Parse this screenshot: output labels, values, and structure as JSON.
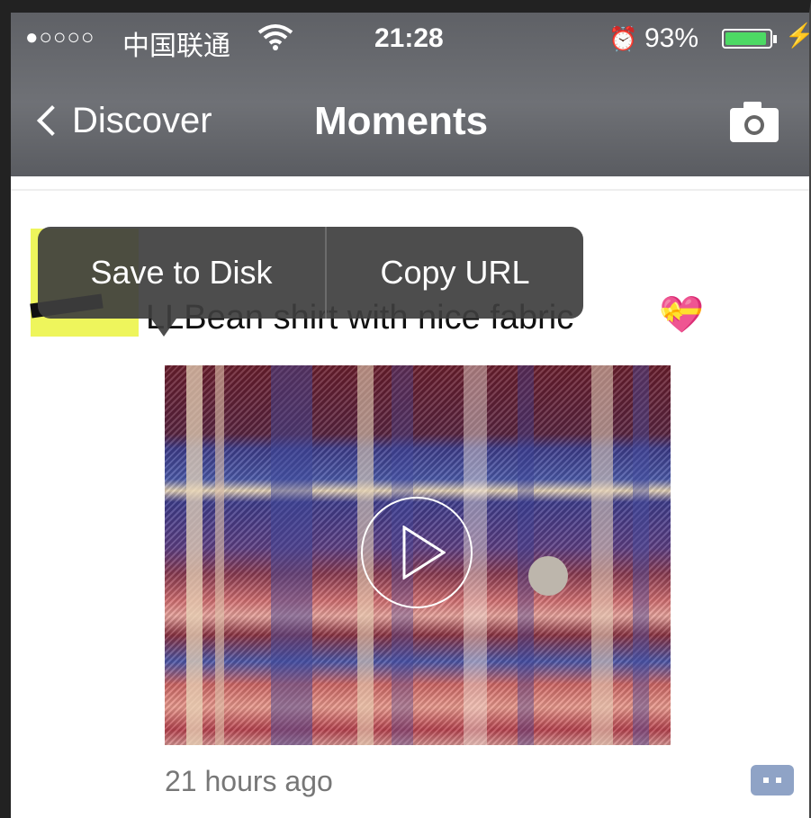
{
  "status_bar": {
    "signal": "●○○○○",
    "carrier": "中国联通",
    "time": "21:28",
    "alarm_icon": "alarm-icon",
    "battery_percent": "93%",
    "battery_level": 0.93
  },
  "nav": {
    "back_label": "Discover",
    "title": "Moments",
    "camera_icon": "camera-icon"
  },
  "popup_menu": {
    "save_label": "Save to Disk",
    "copy_label": "Copy URL"
  },
  "post": {
    "text": "LLBean shirt with nice fabric",
    "emoji": "💝",
    "timestamp": "21 hours ago",
    "video_icon": "play-icon",
    "comment_icon": "comment-icon"
  }
}
